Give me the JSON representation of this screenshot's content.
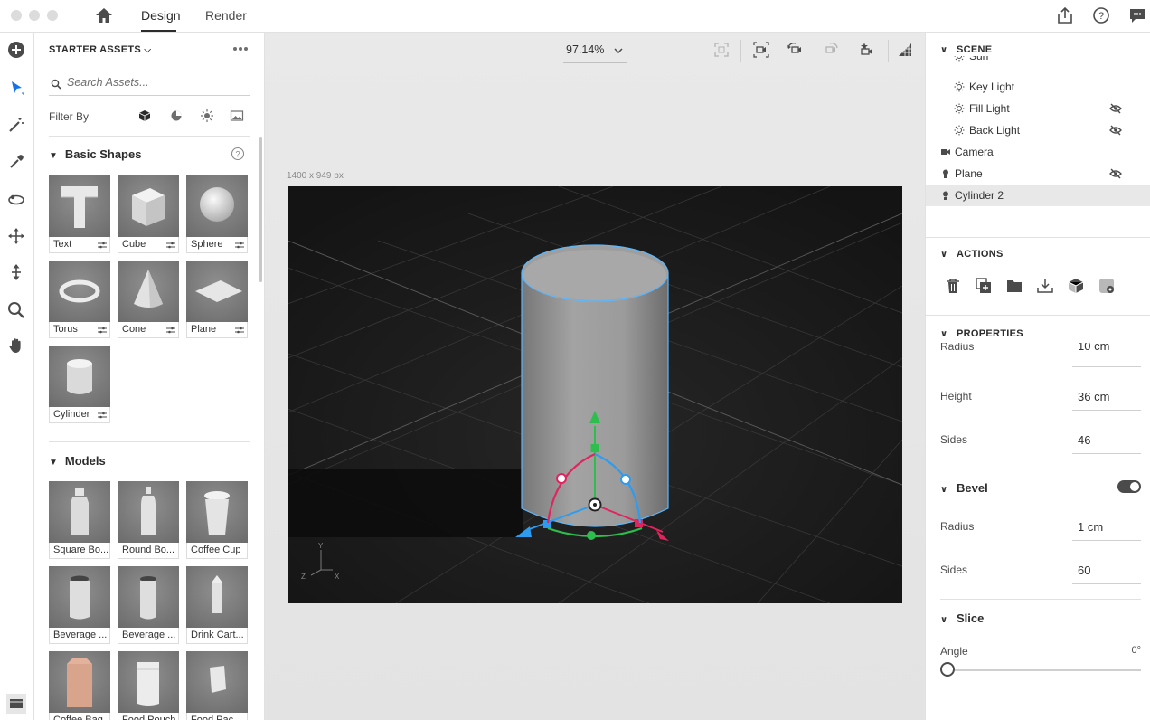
{
  "topbar": {
    "tabs": [
      {
        "label": "Design",
        "active": true
      },
      {
        "label": "Render",
        "active": false
      }
    ]
  },
  "assets": {
    "title": "STARTER ASSETS",
    "search_placeholder": "Search Assets...",
    "filter_label": "Filter By",
    "basic_shapes": {
      "title": "Basic Shapes",
      "items": [
        {
          "label": "Text"
        },
        {
          "label": "Cube"
        },
        {
          "label": "Sphere"
        },
        {
          "label": "Torus"
        },
        {
          "label": "Cone"
        },
        {
          "label": "Plane"
        },
        {
          "label": "Cylinder"
        }
      ]
    },
    "models": {
      "title": "Models",
      "items": [
        {
          "label": "Square Bo..."
        },
        {
          "label": "Round Bo..."
        },
        {
          "label": "Coffee Cup"
        },
        {
          "label": "Beverage ..."
        },
        {
          "label": "Beverage ..."
        },
        {
          "label": "Drink Cart..."
        },
        {
          "label": "Coffee Bag"
        },
        {
          "label": "Food Pouch"
        },
        {
          "label": "Food Pac..."
        }
      ]
    }
  },
  "canvas": {
    "zoom": "97.14%",
    "size_label": "1400 x 949 px",
    "axes": {
      "y": "Y",
      "z": "Z",
      "x": "X"
    }
  },
  "scene": {
    "title": "SCENE",
    "items": [
      {
        "label": "Sun",
        "icon": "sun-icon",
        "hidden": false
      },
      {
        "label": "Key Light",
        "icon": "sun-icon",
        "hidden": false
      },
      {
        "label": "Fill Light",
        "icon": "sun-icon",
        "hidden": true
      },
      {
        "label": "Back Light",
        "icon": "sun-icon",
        "hidden": true
      },
      {
        "label": "Camera",
        "icon": "camera-icon",
        "hidden": false
      },
      {
        "label": "Plane",
        "icon": "object-icon",
        "hidden": true
      },
      {
        "label": "Cylinder 2",
        "icon": "object-icon",
        "hidden": false,
        "selected": true
      }
    ]
  },
  "actions": {
    "title": "ACTIONS",
    "icons": [
      "trash-icon",
      "duplicate-icon",
      "folder-icon",
      "download-icon",
      "cube-icon",
      "material-icon"
    ]
  },
  "properties": {
    "title": "PROPERTIES",
    "radius_label": "Radius",
    "radius_value": "10 cm",
    "height_label": "Height",
    "height_value": "36 cm",
    "sides_label": "Sides",
    "sides_value": "46",
    "bevel": {
      "title": "Bevel",
      "enabled": true,
      "radius_label": "Radius",
      "radius_value": "1 cm",
      "sides_label": "Sides",
      "sides_value": "60"
    },
    "slice": {
      "title": "Slice",
      "angle_label": "Angle",
      "angle_value": "0°",
      "angle_fraction": 0
    }
  },
  "colors": {
    "accent": "#2680eb",
    "gizmo_red": "#e0245e",
    "gizmo_green": "#2dbe4e",
    "gizmo_blue": "#2d9cf0"
  }
}
